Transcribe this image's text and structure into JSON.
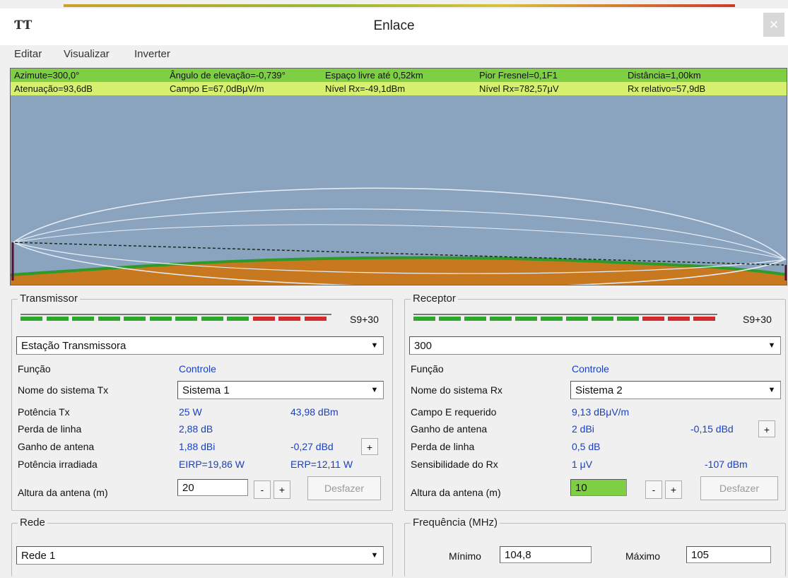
{
  "window": {
    "title": "Enlace",
    "icon": "app-logo-icon",
    "close_glyph": "×"
  },
  "menu": [
    "Editar",
    "Visualizar",
    "Inverter"
  ],
  "profile": {
    "row1": [
      "Azimute=300,0°",
      "Ângulo de elevação=-0,739°",
      "Espaço livre até 0,52km",
      "Pior Fresnel=0,1F1",
      "Distância=1,00km"
    ],
    "row2": [
      "Atenuação=93,6dB",
      "Campo E=67,0dBμV/m",
      "Nível Rx=-49,1dBm",
      "Nível Rx=782,57μV",
      "Rx relativo=57,9dB"
    ],
    "colors": {
      "sky": "#8aa4c0",
      "terrain": "#c8781e",
      "terrain_edge": "#2e9a2a",
      "row1": "#7fcf45",
      "row2": "#d8f070"
    }
  },
  "transmitter": {
    "legend": "Transmissor",
    "meter_label": "S9+30",
    "meter_green": 9,
    "meter_red": 3,
    "station": "Estação Transmissora",
    "funcao_label": "Função",
    "funcao_value": "Controle",
    "sistema_label": "Nome do sistema Tx",
    "sistema_value": "Sistema 1",
    "potencia_label": "Potência Tx",
    "potencia_w": "25 W",
    "potencia_dbm": "43,98 dBm",
    "perda_label": "Perda de linha",
    "perda_value": "2,88 dB",
    "ganho_label": "Ganho de antena",
    "ganho_dbi": "1,88 dBi",
    "ganho_dbd": "-0,27 dBd",
    "irradiada_label": "Potência irradiada",
    "eirp": "EIRP=19,86 W",
    "erp": "ERP=12,11 W",
    "altura_label": "Altura da antena (m)",
    "altura_value": "20",
    "minus": "-",
    "plus": "+",
    "desfazer": "Desfazer"
  },
  "receiver": {
    "legend": "Receptor",
    "meter_label": "S9+30",
    "meter_green": 9,
    "meter_red": 3,
    "station": "300",
    "funcao_label": "Função",
    "funcao_value": "Controle",
    "sistema_label": "Nome do sistema Rx",
    "sistema_value": "Sistema 2",
    "campo_label": "Campo E requerido",
    "campo_value": "9,13 dBμV/m",
    "ganho_label": "Ganho de antena",
    "ganho_dbi": "2 dBi",
    "ganho_dbd": "-0,15 dBd",
    "perda_label": "Perda de linha",
    "perda_value": "0,5 dB",
    "sens_label": "Sensibilidade do Rx",
    "sens_uv": "1 μV",
    "sens_dbm": "-107 dBm",
    "altura_label": "Altura da antena (m)",
    "altura_value": "10",
    "minus": "-",
    "plus": "+",
    "desfazer": "Desfazer"
  },
  "rede": {
    "legend": "Rede",
    "value": "Rede 1"
  },
  "frequencia": {
    "legend": "Frequência (MHz)",
    "min_label": "Mínimo",
    "min_value": "104,8",
    "max_label": "Máximo",
    "max_value": "105"
  }
}
